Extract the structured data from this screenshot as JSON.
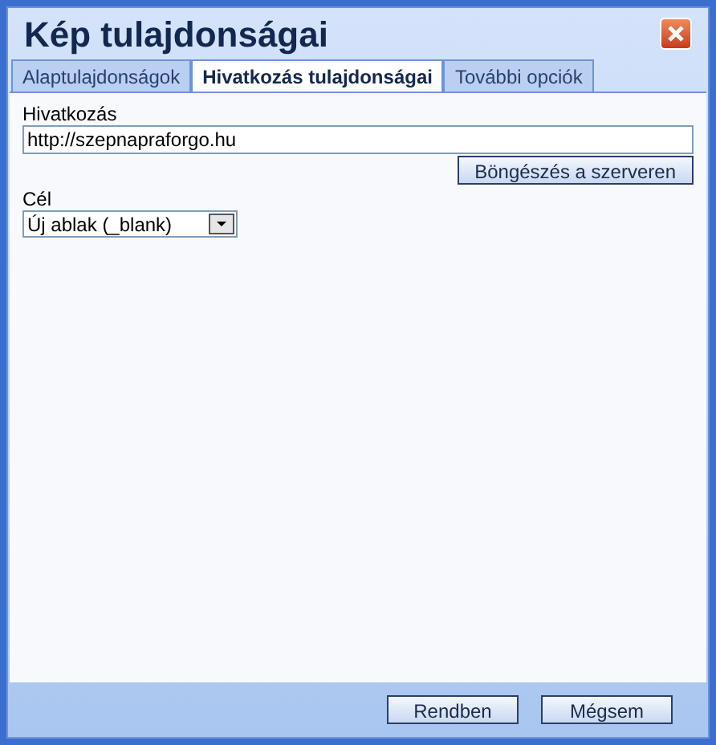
{
  "window": {
    "title": "Kép tulajdonságai"
  },
  "tabs": [
    {
      "label": "Alaptulajdonságok",
      "selected": false
    },
    {
      "label": "Hivatkozás tulajdonságai",
      "selected": true
    },
    {
      "label": "További opciók",
      "selected": false
    }
  ],
  "link": {
    "label": "Hivatkozás",
    "value": "http://szepnapraforgo.hu",
    "browse_button": "Böngészés a szerveren"
  },
  "target": {
    "label": "Cél",
    "value": "Új ablak (_blank)"
  },
  "buttons": [
    "Rendben",
    "Mégsem"
  ]
}
